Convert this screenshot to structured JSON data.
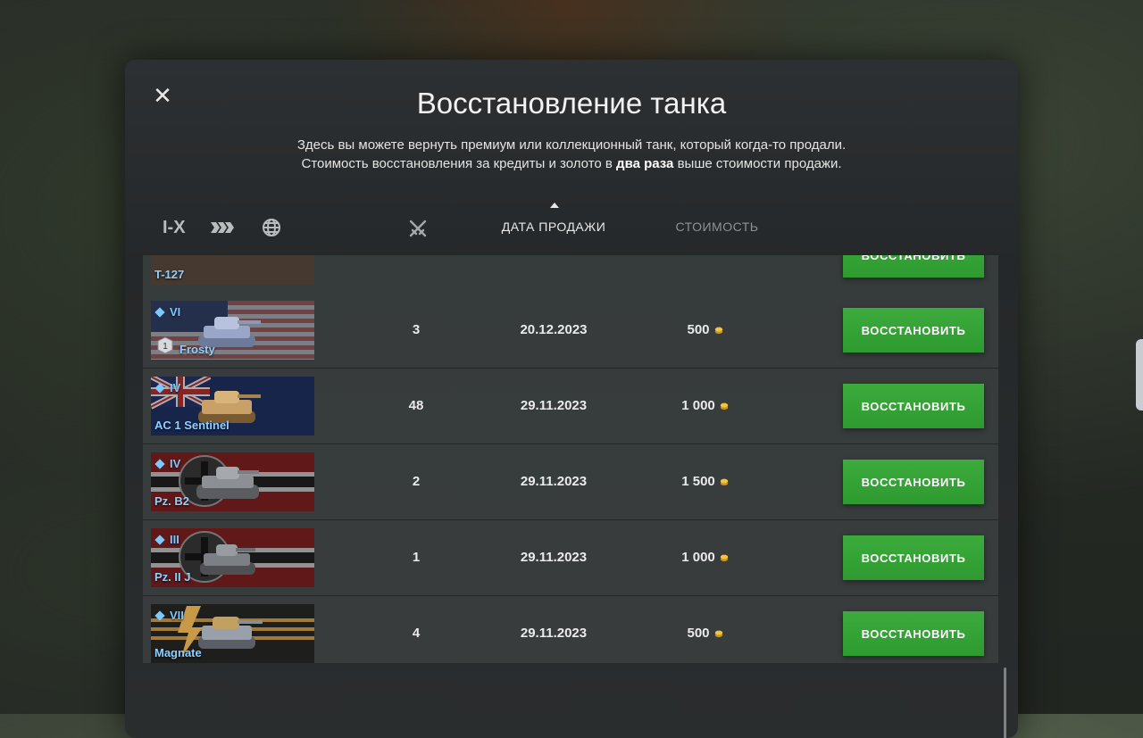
{
  "modal": {
    "title": "Восстановление танка",
    "desc_line1": "Здесь вы можете вернуть премиум или коллекционный танк, который когда-то продали.",
    "desc_line2_pre": "Стоимость восстановления за кредиты и золото в",
    "desc_line2_bold": "два раза",
    "desc_line2_post": "выше стоимости продажи."
  },
  "filters": {
    "tier_label": "I-X"
  },
  "columns": {
    "date": "ДАТА ПРОДАЖИ",
    "cost": "СТОИМОСТЬ"
  },
  "partial_row": {
    "name": "T-127",
    "button": "ВОССТАНОВИТЬ"
  },
  "rows": [
    {
      "tier": "VI",
      "name": "Frosty",
      "battles": "3",
      "date": "20.12.2023",
      "cost": "500",
      "button": "ВОССТАНОВИТЬ",
      "mastery": "1",
      "flag": "usa"
    },
    {
      "tier": "IV",
      "name": "AC 1 Sentinel",
      "battles": "48",
      "date": "29.11.2023",
      "cost": "1 000",
      "button": "ВОССТАНОВИТЬ",
      "flag": "uk"
    },
    {
      "tier": "IV",
      "name": "Pz. B2",
      "battles": "2",
      "date": "29.11.2023",
      "cost": "1 500",
      "button": "ВОССТАНОВИТЬ",
      "flag": "germany"
    },
    {
      "tier": "III",
      "name": "Pz. II J",
      "battles": "1",
      "date": "29.11.2023",
      "cost": "1 000",
      "button": "ВОССТАНОВИТЬ",
      "flag": "germany"
    },
    {
      "tier": "VII",
      "name": "Magnate",
      "battles": "4",
      "date": "29.11.2023",
      "cost": "500",
      "button": "ВОССТАНОВИТЬ",
      "flag": "special"
    }
  ],
  "colors": {
    "button_green": "#3cab3c",
    "tier_blue": "#7cc8ff",
    "gold": "#f2c53d"
  }
}
